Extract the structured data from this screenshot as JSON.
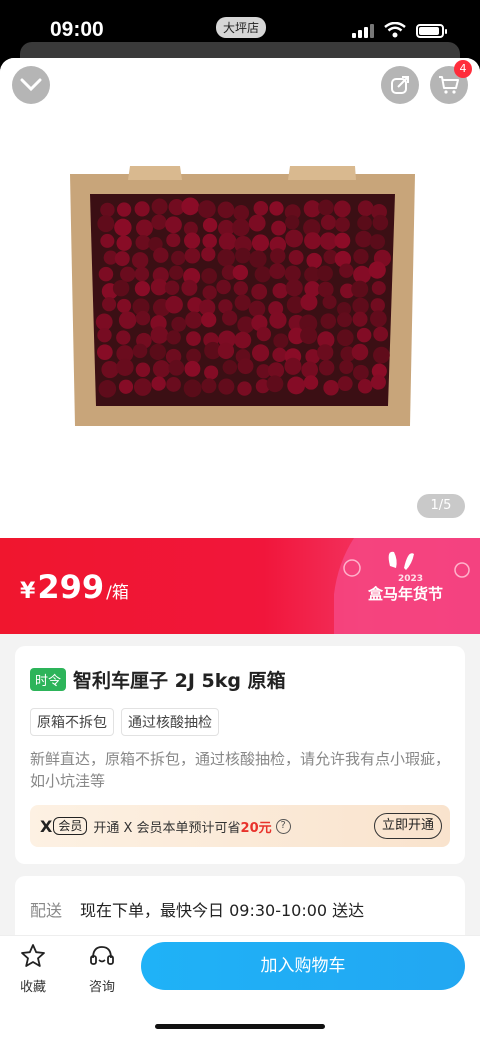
{
  "status_bar": {
    "time": "09:00",
    "store": "大坪店"
  },
  "header": {
    "cart_count": "4",
    "image_counter": "1/5"
  },
  "price": {
    "currency": "¥",
    "value": "299",
    "unit": "/箱"
  },
  "festival": {
    "year": "2023",
    "name": "盒马年货节"
  },
  "product": {
    "season_tag": "时令",
    "title": "智利车厘子 2J 5kg 原箱",
    "tags": [
      "原箱不拆包",
      "通过核酸抽检"
    ],
    "description": "新鲜直达，原箱不拆包，通过核酸抽检，请允许我有点小瑕疵，如小坑洼等"
  },
  "member": {
    "logo": "X",
    "label": "会员",
    "text_prefix": "开通 X 会员本单预计可省",
    "save_amount": "20元",
    "open_button": "立即开通"
  },
  "delivery": {
    "label": "配送",
    "text": "现在下单，最快今日 09:30-10:00 送达"
  },
  "bottom_bar": {
    "favorite": "收藏",
    "consult": "咨询",
    "add_to_cart": "加入购物车"
  },
  "colors": {
    "price_red": "#f0162e",
    "cart_blue": "#1fb2f7",
    "season_green": "#2db45a",
    "save_red": "#e8322b"
  },
  "icons": [
    "chevron-down-icon",
    "share-icon",
    "cart-icon",
    "star-icon",
    "headset-icon"
  ]
}
